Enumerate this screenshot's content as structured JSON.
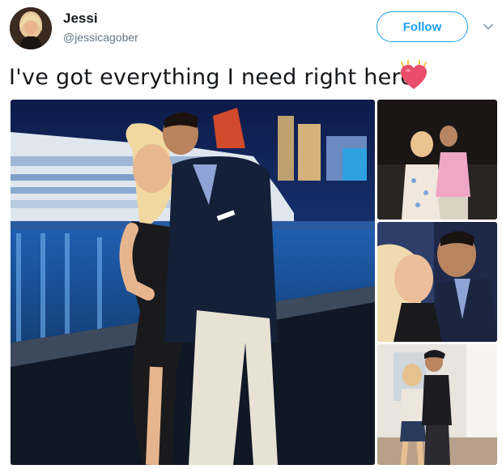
{
  "user": {
    "display_name": "Jessi",
    "handle": "@jessicagober",
    "avatar_icon": "profile-avatar"
  },
  "actions": {
    "follow_label": "Follow",
    "menu_icon": "chevron-down-icon"
  },
  "tweet": {
    "text": "I've got everything I need right here",
    "emoji": "beating-heart-emoji"
  },
  "media": {
    "photo_count": 4
  },
  "colors": {
    "accent": "#1da1f2",
    "text_primary": "#14171a",
    "text_secondary": "#657786",
    "heart": "#ea4d6a"
  }
}
